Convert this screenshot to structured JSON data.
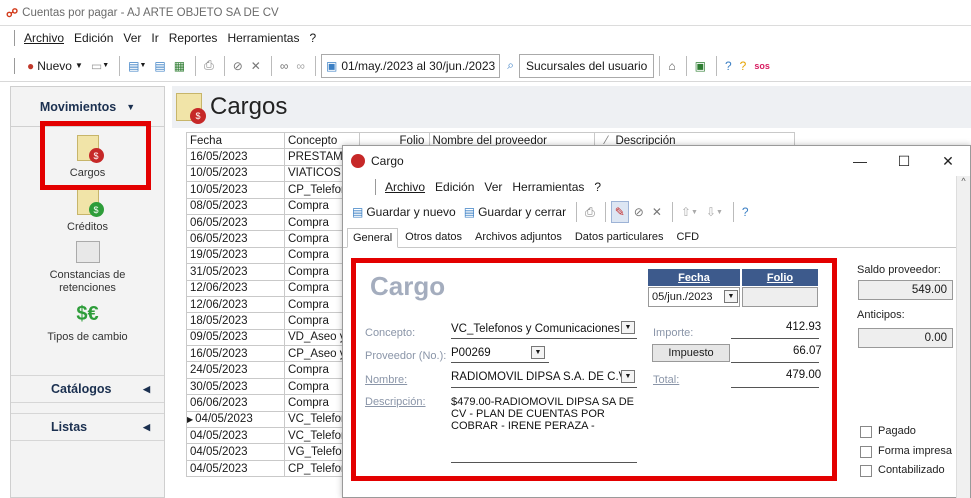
{
  "window": {
    "title": "Cuentas por pagar - AJ ARTE OBJETO SA DE CV"
  },
  "menu": [
    "Archivo",
    "Edición",
    "Ver",
    "Ir",
    "Reportes",
    "Herramientas",
    "?"
  ],
  "toolbar": {
    "nuevo_label": "Nuevo",
    "date_range": "01/may./2023 al 30/jun./2023",
    "sucursales": "Sucursales del usuario",
    "sos_label": "sos"
  },
  "sidebar": {
    "header": "Movimientos",
    "items": [
      {
        "label": "Cargos",
        "icon": "cargos-icon"
      },
      {
        "label": "Créditos",
        "icon": "creditos-icon"
      },
      {
        "label": "Constancias de retenciones",
        "icon": "constancias-icon"
      },
      {
        "label": "Tipos de cambio",
        "icon": "currency-exchange-icon"
      }
    ],
    "sections": [
      "Catálogos",
      "Listas"
    ]
  },
  "content": {
    "title": "Cargos",
    "columns": [
      "Fecha",
      "Concepto",
      "Folio",
      "Nombre del proveedor",
      "Descripción"
    ],
    "rows": [
      {
        "fecha": "16/05/2023",
        "concepto": "PRESTAMO"
      },
      {
        "fecha": "10/05/2023",
        "concepto": "VIATICOS IN"
      },
      {
        "fecha": "10/05/2023",
        "concepto": "CP_Telefon"
      },
      {
        "fecha": "08/05/2023",
        "concepto": "Compra"
      },
      {
        "fecha": "06/05/2023",
        "concepto": "Compra"
      },
      {
        "fecha": "06/05/2023",
        "concepto": "Compra"
      },
      {
        "fecha": "19/05/2023",
        "concepto": "Compra"
      },
      {
        "fecha": "31/05/2023",
        "concepto": "Compra"
      },
      {
        "fecha": "12/06/2023",
        "concepto": "Compra"
      },
      {
        "fecha": "12/06/2023",
        "concepto": "Compra"
      },
      {
        "fecha": "18/05/2023",
        "concepto": "Compra"
      },
      {
        "fecha": "09/05/2023",
        "concepto": "VD_Aseo y L"
      },
      {
        "fecha": "16/05/2023",
        "concepto": "CP_Aseo y L"
      },
      {
        "fecha": "24/05/2023",
        "concepto": "Compra"
      },
      {
        "fecha": "30/05/2023",
        "concepto": "Compra"
      },
      {
        "fecha": "06/06/2023",
        "concepto": "Compra"
      },
      {
        "fecha": "04/05/2023",
        "concepto": "VC_Telefono"
      },
      {
        "fecha": "04/05/2023",
        "concepto": "VC_Telefono"
      },
      {
        "fecha": "04/05/2023",
        "concepto": "VG_Telefono"
      },
      {
        "fecha": "04/05/2023",
        "concepto": "CP_Telefono"
      }
    ]
  },
  "dialog": {
    "title": "Cargo",
    "menu": [
      "Archivo",
      "Edición",
      "Ver",
      "Herramientas",
      "?"
    ],
    "guardar_nuevo": "Guardar y nuevo",
    "guardar_cerrar": "Guardar y cerrar",
    "tabs": [
      "General",
      "Otros datos",
      "Archivos adjuntos",
      "Datos particulares",
      "CFD"
    ],
    "form": {
      "heading": "Cargo",
      "fecha_label": "Fecha",
      "folio_label": "Folio",
      "fecha_value": "05/jun./2023",
      "folio_value": "",
      "concepto_label": "Concepto:",
      "concepto_value": "VC_Telefonos y Comunicaciones",
      "proveedor_label": "Proveedor (No.):",
      "proveedor_value": "P00269",
      "nombre_label": "Nombre:",
      "nombre_value": "RADIOMOVIL DIPSA S.A. DE C.V.",
      "descripcion_label": "Descripción:",
      "descripcion_value": "$479.00-RADIOMOVIL DIPSA SA DE CV - PLAN DE CUENTAS POR COBRAR - IRENE PERAZA -",
      "importe_label": "Importe:",
      "importe_value": "412.93",
      "impuesto_label": "Impuesto",
      "impuesto_value": "66.07",
      "total_label": "Total:",
      "total_value": "479.00"
    },
    "side": {
      "saldo_label": "Saldo proveedor:",
      "saldo_value": "549.00",
      "anticipos_label": "Anticipos:",
      "anticipos_value": "0.00",
      "pagado_label": "Pagado",
      "forma_label": "Forma impresa",
      "contab_label": "Contabilizado"
    }
  },
  "colors": {
    "highlight_red": "#e30000",
    "header_blue": "#3d5a8c",
    "label_gray": "#8a95a8"
  }
}
